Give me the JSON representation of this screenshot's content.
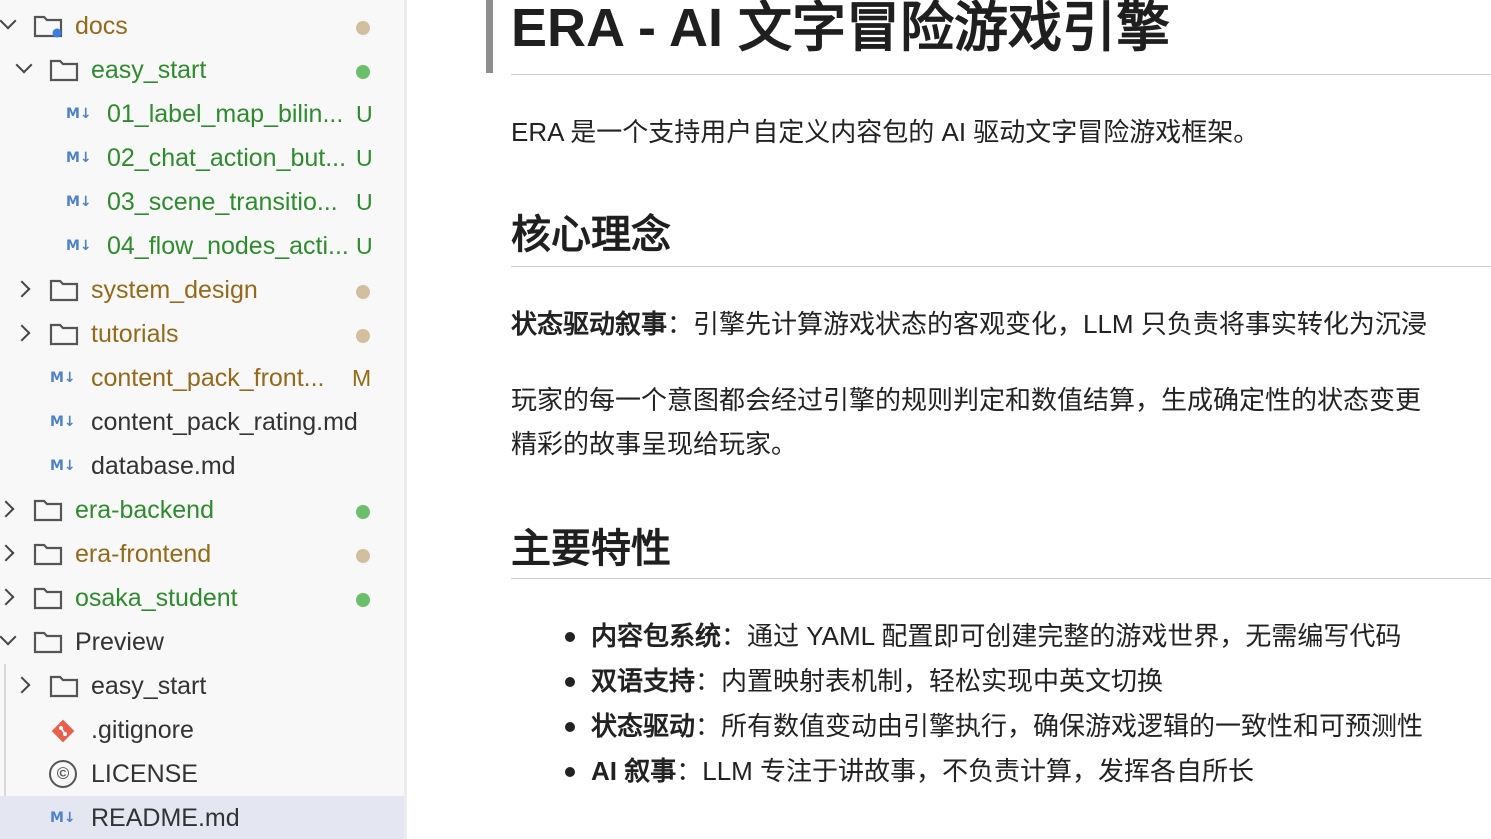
{
  "explorer": {
    "items": [
      {
        "label": "docs",
        "status": "",
        "dot": "#c9b89a",
        "color": "#946a1a"
      },
      {
        "label": "easy_start",
        "status": "",
        "dot": "#6cbf6c",
        "color": "#2e8b2e"
      },
      {
        "label": "01_label_map_bilin...",
        "status": "U",
        "color": "#2e8b2e"
      },
      {
        "label": "02_chat_action_but...",
        "status": "U",
        "color": "#2e8b2e"
      },
      {
        "label": "03_scene_transitio...",
        "status": "U",
        "color": "#2e8b2e"
      },
      {
        "label": "04_flow_nodes_acti...",
        "status": "U",
        "color": "#2e8b2e"
      },
      {
        "label": "system_design",
        "status": "",
        "dot": "#c9b89a",
        "color": "#946a1a"
      },
      {
        "label": "tutorials",
        "status": "",
        "dot": "#c9b89a",
        "color": "#946a1a"
      },
      {
        "label": "content_pack_front...",
        "status": "M",
        "color": "#946a1a"
      },
      {
        "label": "content_pack_rating.md",
        "status": "",
        "color": "#333333"
      },
      {
        "label": "database.md",
        "status": "",
        "color": "#333333"
      },
      {
        "label": "era-backend",
        "status": "",
        "dot": "#6cbf6c",
        "color": "#2e8b2e"
      },
      {
        "label": "era-frontend",
        "status": "",
        "dot": "#c9b89a",
        "color": "#946a1a"
      },
      {
        "label": "osaka_student",
        "status": "",
        "dot": "#6cbf6c",
        "color": "#2e8b2e"
      },
      {
        "label": "Preview",
        "status": "",
        "color": "#333333"
      },
      {
        "label": "easy_start",
        "status": "",
        "color": "#333333"
      },
      {
        "label": ".gitignore",
        "status": "",
        "color": "#333333"
      },
      {
        "label": "LICENSE",
        "status": "",
        "color": "#333333"
      },
      {
        "label": "README.md",
        "status": "",
        "color": "#333333"
      }
    ],
    "md_icon": "M↓",
    "license_glyph": "©"
  },
  "preview": {
    "title": "ERA - AI 文字冒险游戏引擎",
    "intro": "ERA 是一个支持用户自定义内容包的 AI 驱动文字冒险游戏框架。",
    "section1": {
      "heading": "核心理念",
      "p1_bold": "状态驱动叙事",
      "p1_text": "：引擎先计算游戏状态的客观变化，LLM 只负责将事实转化为沉浸",
      "p2_line1": "玩家的每一个意图都会经过引擎的规则判定和数值结算，生成确定性的状态变更",
      "p2_line2": "精彩的故事呈现给玩家。"
    },
    "section2": {
      "heading": "主要特性",
      "items": [
        {
          "bold": "内容包系统",
          "text": "：通过 YAML 配置即可创建完整的游戏世界，无需编写代码"
        },
        {
          "bold": "双语支持",
          "text": "：内置映射表机制，轻松实现中英文切换"
        },
        {
          "bold": "状态驱动",
          "text": "：所有数值变动由引擎执行，确保游戏逻辑的一致性和可预测性"
        },
        {
          "bold": "AI 叙事",
          "text": "：LLM 专注于讲故事，不负责计算，发挥各自所长"
        }
      ]
    }
  }
}
